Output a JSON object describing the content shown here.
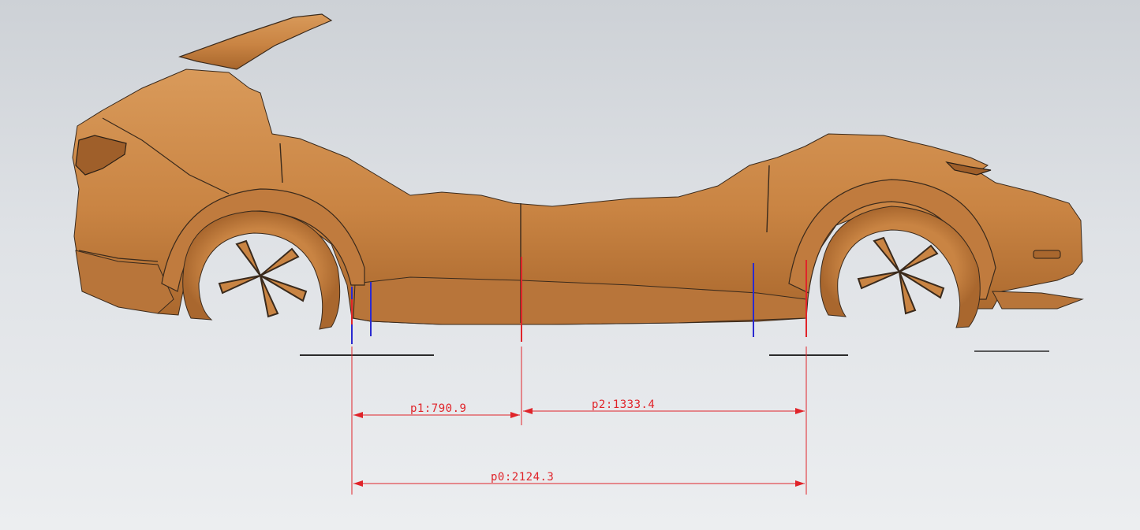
{
  "viewport": {
    "background_top": "#cdd1d6",
    "background_bottom": "#eceef0"
  },
  "model": {
    "body_color": "#cd8a4b",
    "body_shadow": "#a9672e",
    "edge_color": "#3a2a1c"
  },
  "dimension_color": "#e0242a",
  "marker_color": "#2a2ad0",
  "dimensions": {
    "p1": {
      "label": "p1:790.9"
    },
    "p2": {
      "label": "p2:1333.4"
    },
    "p0": {
      "label": "p0:2124.3"
    }
  }
}
